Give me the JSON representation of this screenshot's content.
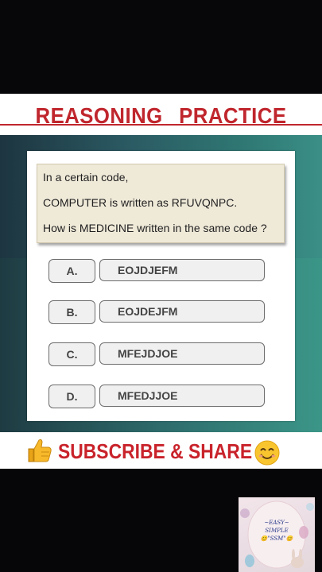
{
  "title": "REASONING PRACTICE",
  "question": {
    "line1": "In a certain code,",
    "line2": "COMPUTER is written as RFUVQNPC.",
    "line3": "How is MEDICINE written in the same code ?"
  },
  "options": [
    {
      "label": "A.",
      "value": "EOJDJEFM"
    },
    {
      "label": "B.",
      "value": "EOJDEJFM"
    },
    {
      "label": "C.",
      "value": "MFEJDJOE"
    },
    {
      "label": "D.",
      "value": "MFEDJJOE"
    }
  ],
  "footer": {
    "text": "SUBSCRIBE & SHARE",
    "left_icon": "thumbs-up-icon",
    "right_icon": "smiley-icon"
  },
  "logo": {
    "line1": "~EASY~",
    "line2": "SIMPLE",
    "line3": "😊\"SSM\"😊"
  },
  "colors": {
    "title_red": "#c0262d",
    "subscribe_red": "#c9232b",
    "question_bg": "#efe9d8",
    "option_bg": "#f0f0f0"
  }
}
